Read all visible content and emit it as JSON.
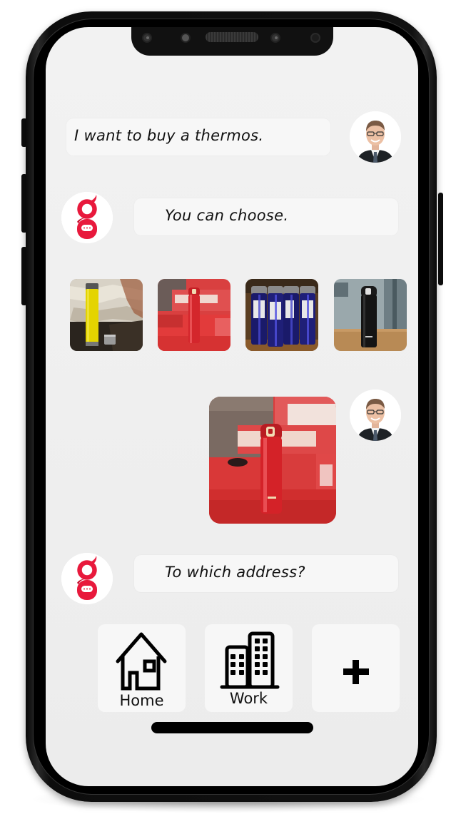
{
  "app": {
    "accent_color": "#e8193c",
    "background_color": "#efefef",
    "bubble_color": "#f7f7f7"
  },
  "conversation": {
    "messages": [
      {
        "sender": "user",
        "type": "text",
        "text": "I want to buy a thermos.",
        "avatar_icon": "user-avatar-icon"
      },
      {
        "sender": "bot",
        "type": "text",
        "text": "You can choose.",
        "avatar_icon": "bot-logo-icon"
      },
      {
        "sender": "bot",
        "type": "image-options",
        "options": [
          {
            "description": "Yellow thermos flask on rustic wood"
          },
          {
            "description": "Red slim thermos on red chairs"
          },
          {
            "description": "Blue sports bottles in a row"
          },
          {
            "description": "Black slim thermos on wooden table"
          }
        ]
      },
      {
        "sender": "user",
        "type": "image",
        "description": "Red slim thermos on red chairs",
        "avatar_icon": "user-avatar-icon"
      },
      {
        "sender": "bot",
        "type": "text",
        "text": "To which address?",
        "avatar_icon": "bot-logo-icon"
      }
    ],
    "address_options": [
      {
        "label": "Home",
        "icon": "home-icon"
      },
      {
        "label": "Work",
        "icon": "office-building-icon"
      },
      {
        "label": "",
        "icon": "plus-icon"
      }
    ]
  }
}
